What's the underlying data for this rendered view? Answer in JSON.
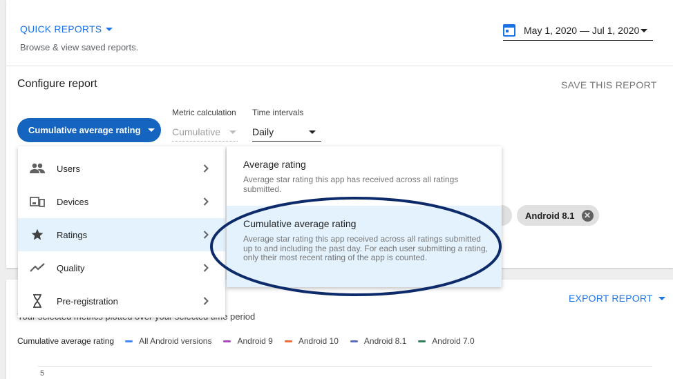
{
  "quick_reports": {
    "title": "QUICK REPORTS",
    "subtitle": "Browse & view saved reports."
  },
  "date_range": {
    "value": "May 1, 2020 — Jul 1, 2020"
  },
  "configure": {
    "title": "Configure report",
    "save_label": "SAVE THIS REPORT",
    "metric_button": "Cumulative average rating",
    "metric_calculation": {
      "label": "Metric calculation",
      "value": "Cumulative"
    },
    "time_intervals": {
      "label": "Time intervals",
      "value": "Daily"
    }
  },
  "chips": {
    "android_81": "Android 8.1"
  },
  "menu": {
    "categories": [
      {
        "label": "Users",
        "icon": "users-icon"
      },
      {
        "label": "Devices",
        "icon": "devices-icon"
      },
      {
        "label": "Ratings",
        "icon": "star-icon",
        "active": true
      },
      {
        "label": "Quality",
        "icon": "trend-icon"
      },
      {
        "label": "Pre-registration",
        "icon": "hourglass-icon"
      }
    ],
    "ratings_submenu": [
      {
        "title": "Average rating",
        "description": "Average star rating this app has received across all ratings submitted."
      },
      {
        "title": "Cumulative average rating",
        "description": "Average star rating this app received across all ratings submitted up to and including the past day. For each user submitting a rating, only their most recent rating of the app is counted.",
        "active": true
      }
    ]
  },
  "chart": {
    "export_label": "EXPORT REPORT",
    "subtitle": "Your selected metrics plotted over your selected time period",
    "legend_title": "Cumulative average rating",
    "legend": [
      {
        "name": "All Android versions",
        "color": "#4285f4"
      },
      {
        "name": "Android 9",
        "color": "#ab47bc"
      },
      {
        "name": "Android 10",
        "color": "#ef6c36"
      },
      {
        "name": "Android 8.1",
        "color": "#5c6bc0"
      },
      {
        "name": "Android 7.0",
        "color": "#2e7d5b"
      }
    ],
    "y_tick_top": "5"
  },
  "colors": {
    "accent": "#1a73e8",
    "button_blue": "#1565c0",
    "highlight_ring": "#0d2a6b",
    "active_row": "#e3f2fd"
  }
}
